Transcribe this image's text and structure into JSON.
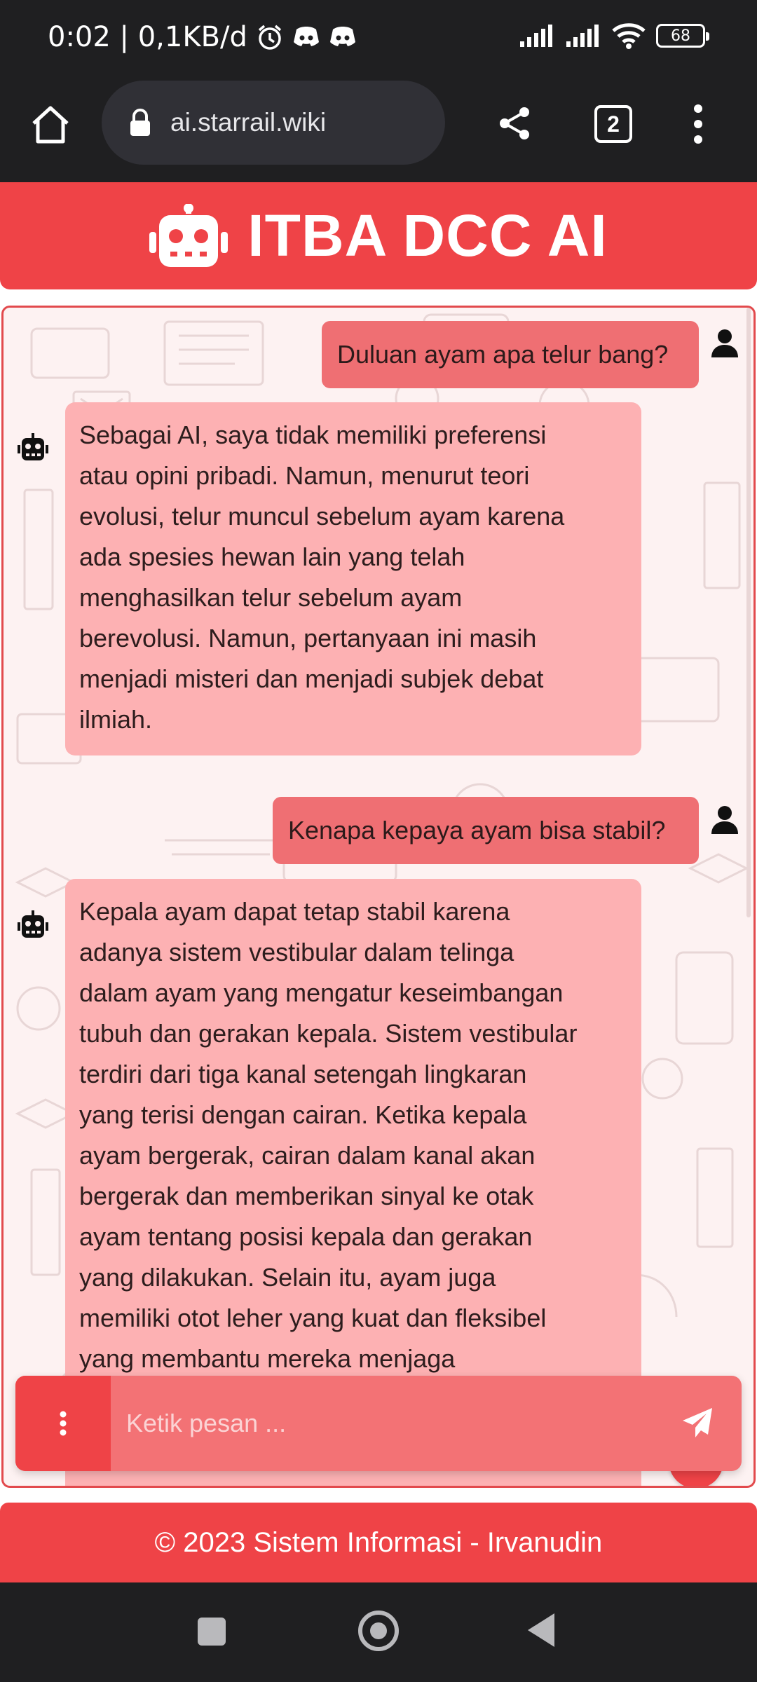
{
  "status_bar": {
    "time_and_speed": "0:02 | 0,1KB/d",
    "battery_level": "68"
  },
  "browser": {
    "url": "ai.starrail.wiki",
    "tab_count": "2"
  },
  "app": {
    "title": "ITBA DCC AI",
    "accent_color": "#ef4347"
  },
  "messages": [
    {
      "role": "user",
      "text": "Duluan ayam apa telur bang?"
    },
    {
      "role": "bot",
      "lines": [
        "Sebagai AI, saya tidak memiliki preferensi",
        "atau opini pribadi. Namun, menurut teori",
        "evolusi, telur muncul sebelum ayam karena",
        "ada spesies hewan lain yang telah",
        "menghasilkan telur sebelum ayam",
        "berevolusi. Namun, pertanyaan ini masih",
        "menjadi misteri dan menjadi subjek debat",
        "ilmiah."
      ]
    },
    {
      "role": "user",
      "text": "Kenapa kepaya ayam bisa stabil?"
    },
    {
      "role": "bot",
      "lines": [
        "Kepala ayam dapat tetap stabil karena",
        "adanya sistem vestibular dalam telinga",
        "dalam ayam yang mengatur keseimbangan",
        "tubuh dan gerakan kepala. Sistem vestibular",
        "terdiri dari tiga kanal setengah lingkaran",
        "yang terisi dengan cairan. Ketika kepala",
        "ayam bergerak, cairan dalam kanal akan",
        "bergerak dan memberikan sinyal ke otak",
        "ayam tentang posisi kepala dan gerakan",
        "yang dilakukan. Selain itu, ayam juga",
        "memiliki otot leher yang kuat dan fleksibel",
        "yang membantu mereka menjaga"
      ]
    }
  ],
  "composer": {
    "placeholder": "Ketik pesan ..."
  },
  "footer": {
    "text": "© 2023 Sistem Informasi - Irvanudin"
  },
  "icons": {
    "home": "home-icon",
    "lock": "lock-icon",
    "share": "share-icon",
    "menu": "more-vertical-icon",
    "robot": "robot-icon",
    "user": "user-icon",
    "send": "paper-plane-icon",
    "scroll_down": "chevron-down-icon"
  }
}
